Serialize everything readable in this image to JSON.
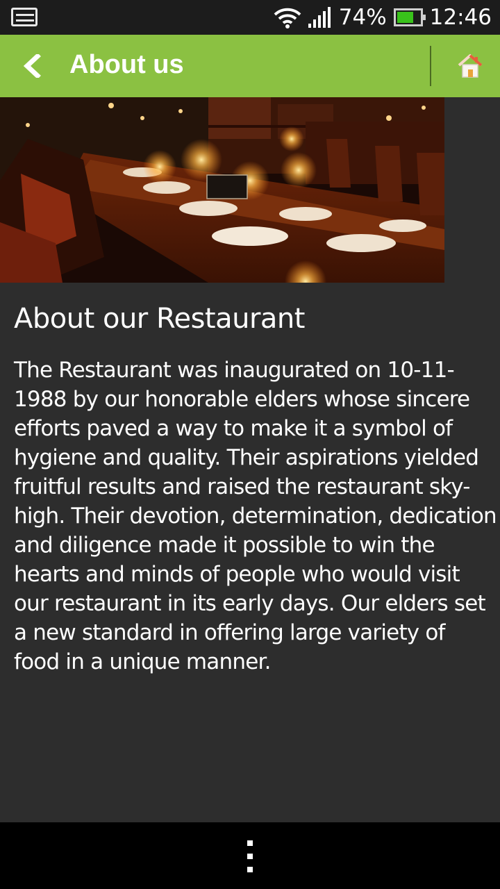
{
  "status_bar": {
    "battery_percent": "74%",
    "time": "12:46",
    "icons": [
      "gallery-icon",
      "wifi-icon",
      "signal-icon",
      "battery-icon"
    ],
    "battery_level": 0.74,
    "battery_color": "#39c21b"
  },
  "action_bar": {
    "title": "About us",
    "background_color": "#8bc142",
    "icons": [
      "back-chevron-icon",
      "home-icon"
    ]
  },
  "hero": {
    "image_subject": "restaurant dining table with candles"
  },
  "content": {
    "heading": "About our Restaurant",
    "body": "The Restaurant was inaugurated on 10-11-1988 by our honorable elders whose sincere efforts paved a way to make it a symbol of hygiene and quality. Their aspirations yielded fruitful results and raised the restaurant sky-high. Their devotion, determination, dedication and diligence made it possible to win the hearts and minds of people who would visit our restaurant in its early days. Our elders set a new standard in offering large variety of food in a unique manner."
  },
  "nav_bar": {
    "icons": [
      "overflow-menu-icon"
    ]
  }
}
